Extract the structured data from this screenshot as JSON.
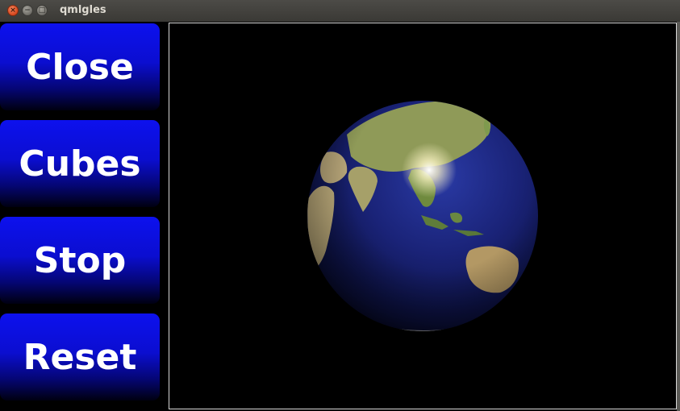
{
  "window": {
    "title": "qmlgles"
  },
  "titlebar_icons": [
    "close-icon",
    "minimize-icon",
    "maximize-icon"
  ],
  "buttons": [
    {
      "label": "Close"
    },
    {
      "label": "Cubes"
    },
    {
      "label": "Stop"
    },
    {
      "label": "Reset"
    }
  ],
  "scene": {
    "object": "earth-globe",
    "background": "#000000"
  },
  "colors": {
    "button_blue": "#0d11ee",
    "close_orange": "#e2572a"
  }
}
